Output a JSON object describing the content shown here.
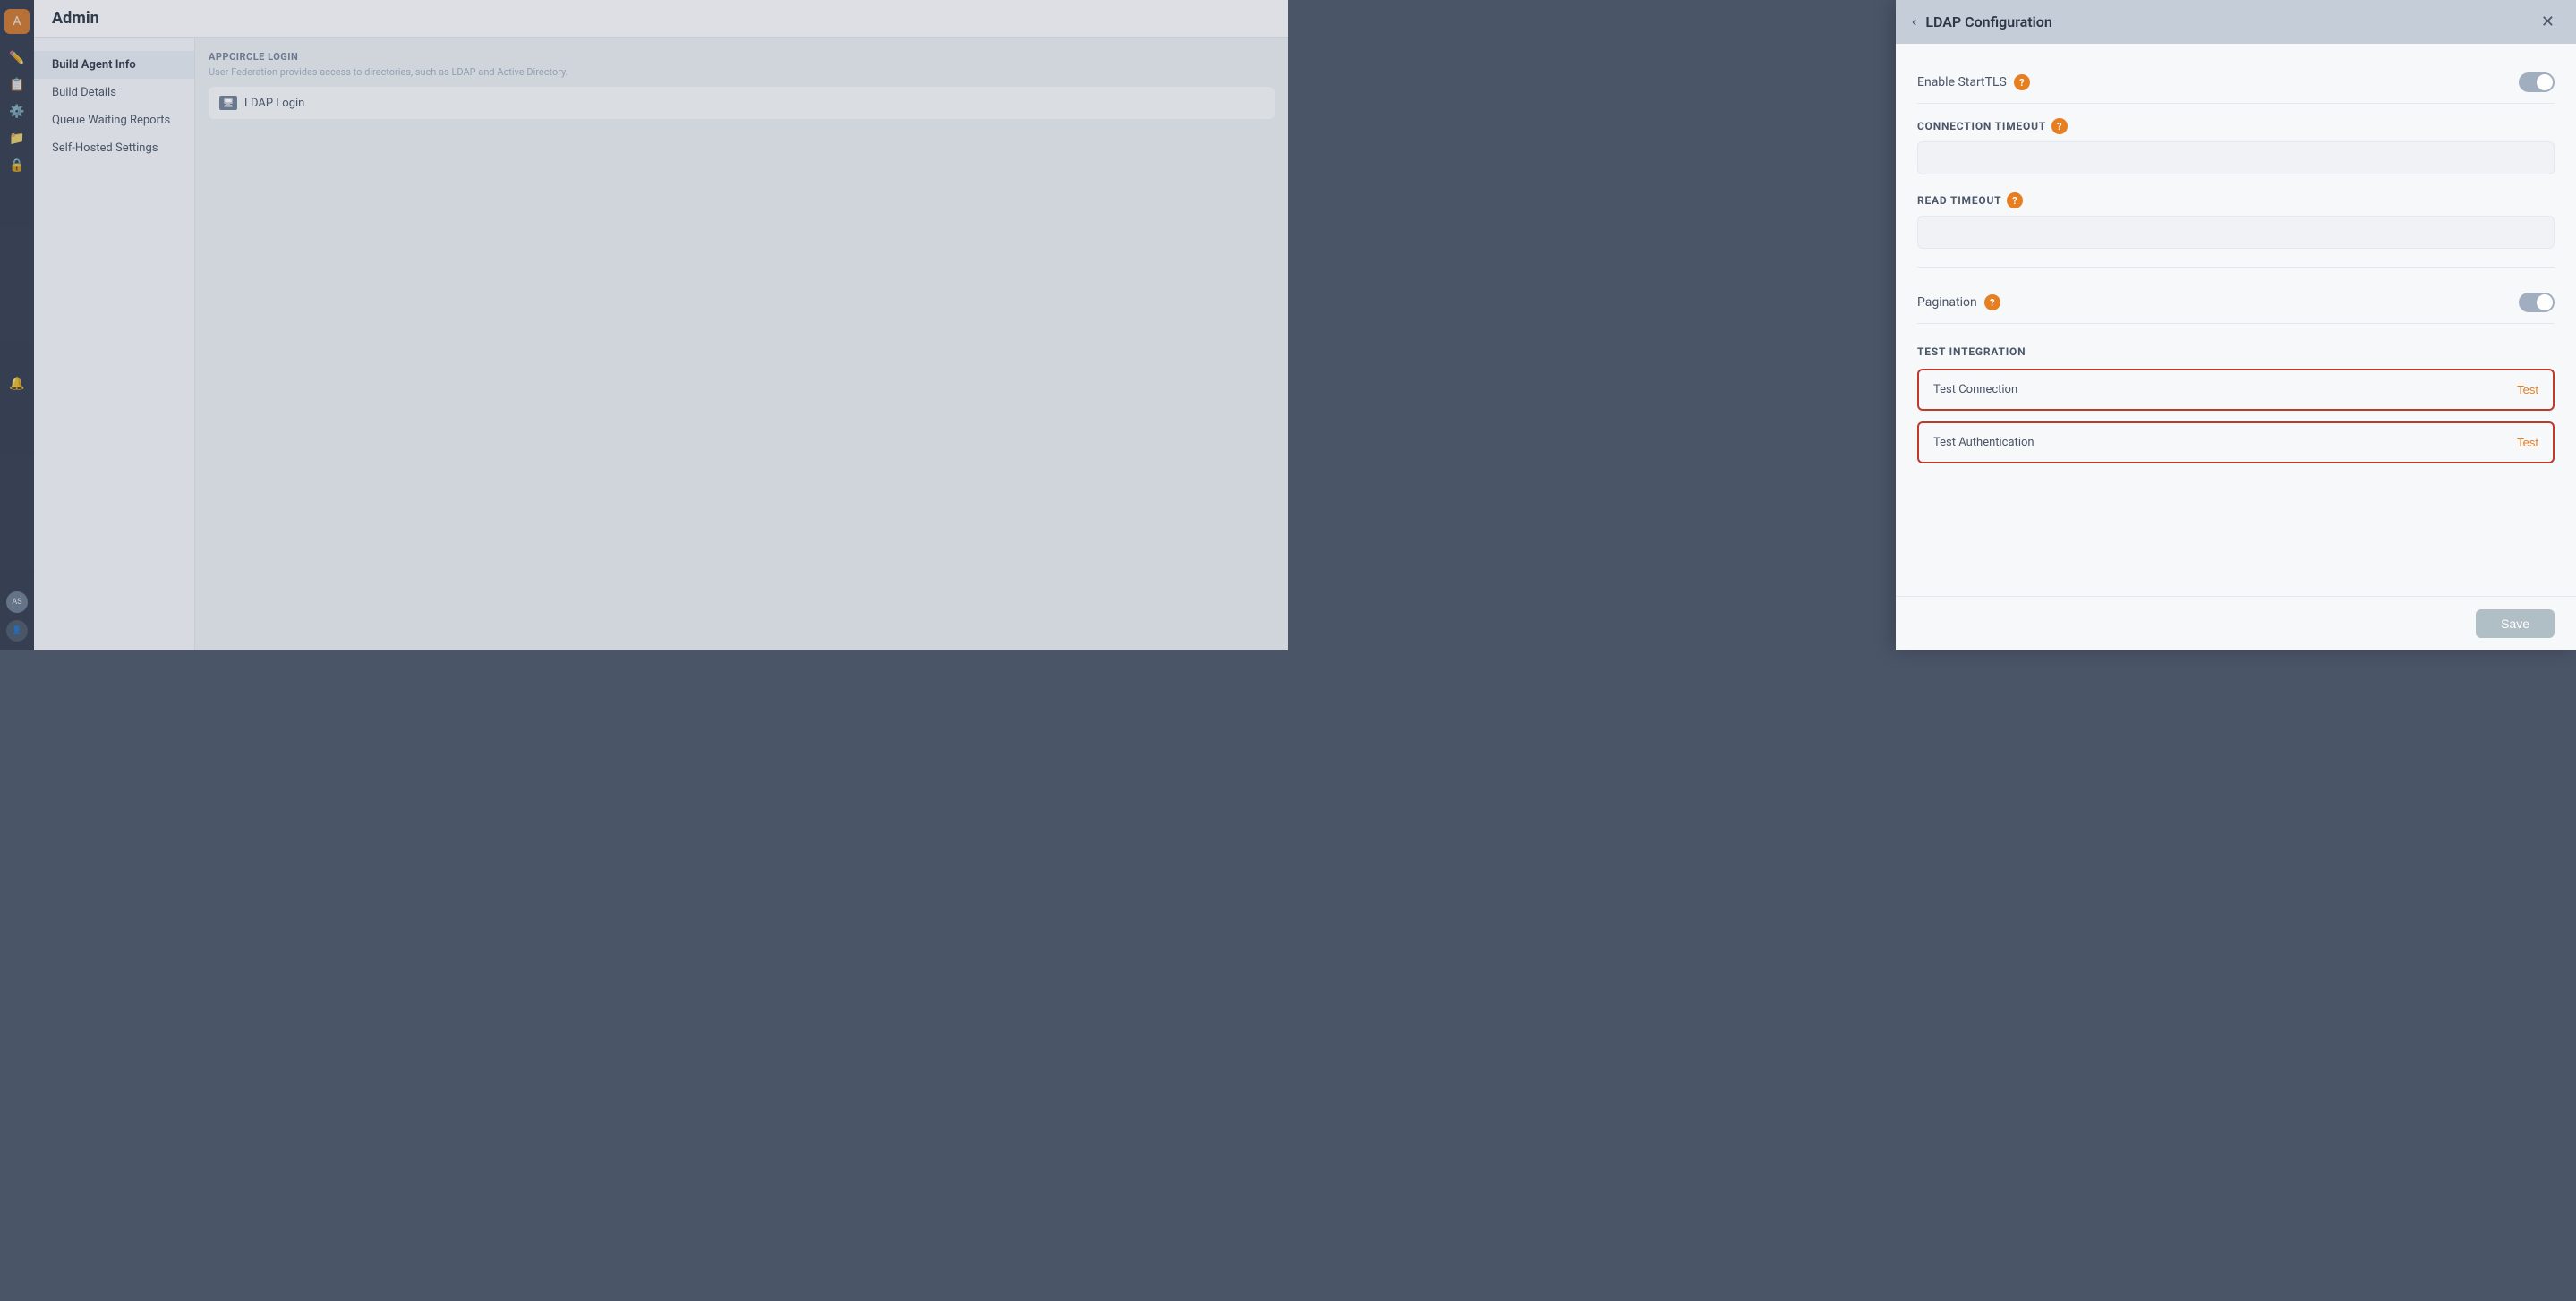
{
  "app": {
    "title": "Admin"
  },
  "sidebar": {
    "logo_text": "A",
    "avatar_text": "AS",
    "avatar2_text": "👤",
    "icons": [
      "✏️",
      "📋",
      "⚙️",
      "📁",
      "🔒",
      "🔔"
    ]
  },
  "left_nav": {
    "items": [
      {
        "label": "Build Agent Info",
        "active": true
      },
      {
        "label": "Build Details",
        "active": false
      },
      {
        "label": "Queue Waiting Reports",
        "active": false
      },
      {
        "label": "Self-Hosted Settings",
        "active": false
      }
    ]
  },
  "center": {
    "section_title": "APPCIRCLE LOGIN",
    "section_subtitle": "User Federation provides access to directories, such as LDAP and Active Directory.",
    "ldap_item_label": "LDAP Login"
  },
  "ldap_panel": {
    "title": "LDAP Configuration",
    "back_label": "‹",
    "close_label": "✕",
    "enable_starttls_label": "Enable StartTLS",
    "connection_timeout_label": "CONNECTION TIMEOUT",
    "read_timeout_label": "READ TIMEOUT",
    "pagination_label": "Pagination",
    "test_integration_title": "TEST INTEGRATION",
    "test_connection_label": "Test Connection",
    "test_connection_action": "Test",
    "test_auth_label": "Test Authentication",
    "test_auth_action": "Test",
    "save_label": "Save",
    "connection_timeout_value": "",
    "read_timeout_value": "",
    "connection_timeout_placeholder": "",
    "read_timeout_placeholder": ""
  }
}
